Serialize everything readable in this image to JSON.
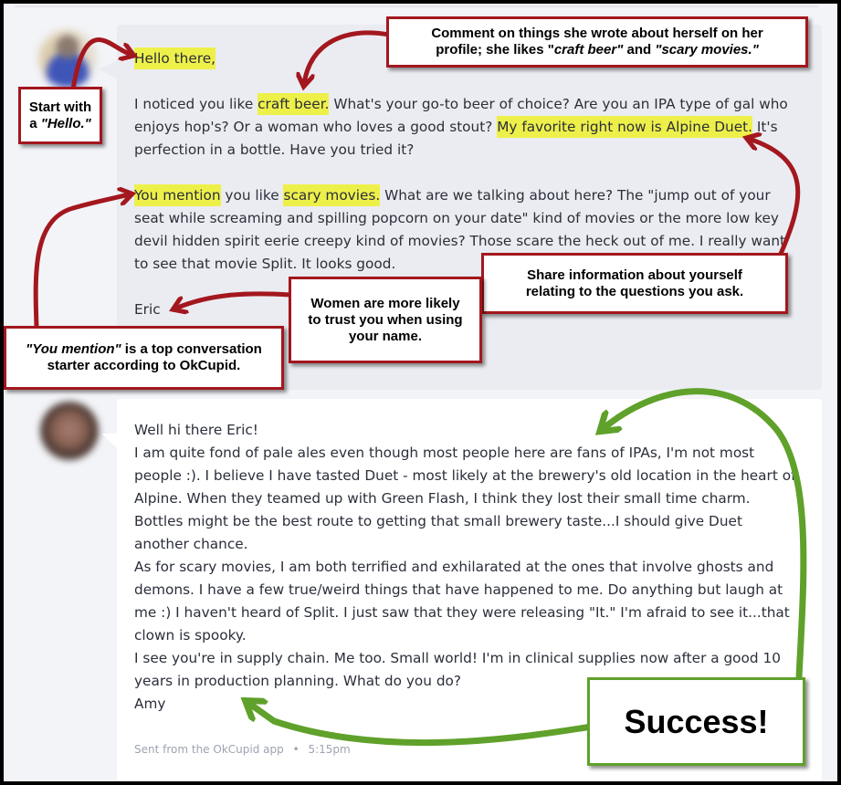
{
  "conversation": {
    "sent_message": {
      "sender": "Eric",
      "greeting": "Hello there,",
      "paragraph1": {
        "before": "I noticed you like ",
        "highlight1": "craft beer.",
        "middle": " What's your go-to beer of choice? Are you an IPA type of gal who enjoys hop's? Or a woman who loves a good stout? ",
        "highlight2": "My favorite right now is Alpine Duet.",
        "after": " It's perfection in a bottle. Have you tried it?"
      },
      "paragraph2": {
        "highlight1": "You mention",
        "middle": " you like ",
        "highlight2": "scary movies.",
        "after": " What are we talking about here? The \"jump out of your seat while screaming and spilling popcorn on your date\" kind of movies or the more low key devil hidden spirit eerie creepy kind of movies? Those scare the heck out of me. I really want to see that movie Split. It looks good."
      },
      "signature": "Eric"
    },
    "received_message": {
      "sender": "Amy",
      "lines": [
        "Well hi there Eric!",
        "I am quite fond of pale ales even though most people here are fans of IPAs, I'm not most people :). I believe I have tasted Duet - most likely at the brewery's old location in the heart of Alpine. When they teamed up with Green Flash, I think they lost their small time charm. Bottles might be the best route to getting that small brewery taste...I should give Duet another chance.",
        "As for scary movies, I am both terrified and exhilarated at the ones that involve ghosts and demons. I have a few true/weird things that have happened to me. Do anything but laugh at me :) I haven't heard of Split. I just saw that they were releasing \"It.\" I'm afraid to see it...that clown is spooky.",
        "I see you're in supply chain. Me too. Small world! I'm in clinical supplies now after a good 10 years in production planning. What do you do?",
        "Amy"
      ],
      "meta_source": "Sent from the OkCupid app",
      "meta_separator": "•",
      "meta_time": "5:15pm"
    }
  },
  "annotations": {
    "hello": {
      "line1": "Start with",
      "line2_prefix": "a ",
      "line2_italic": "\"Hello.\""
    },
    "profile": {
      "line1": "Comment on things she wrote about herself on her",
      "line2_prefix": "profile; she likes \"",
      "line2_italic1": "craft beer\"",
      "line2_mid": " and ",
      "line2_italic2": "\"scary movies.\""
    },
    "share": {
      "line1": "Share information about yourself",
      "line2": "relating to the questions you ask."
    },
    "name": {
      "line1": "Women are more likely",
      "line2": "to trust you when using",
      "line3": "your name."
    },
    "mention": {
      "line1_italic": "\"You mention\"",
      "line1_rest": " is a top conversation",
      "line2": "starter according to OkCupid."
    },
    "success": {
      "label": "Success!"
    }
  },
  "colors": {
    "highlight": "#eef04a",
    "annotation_red": "#a3171e",
    "annotation_green": "#5fa12a",
    "sent_bubble": "#ebecf1",
    "received_bubble": "#ffffff",
    "page_bg": "#f3f4f8"
  }
}
